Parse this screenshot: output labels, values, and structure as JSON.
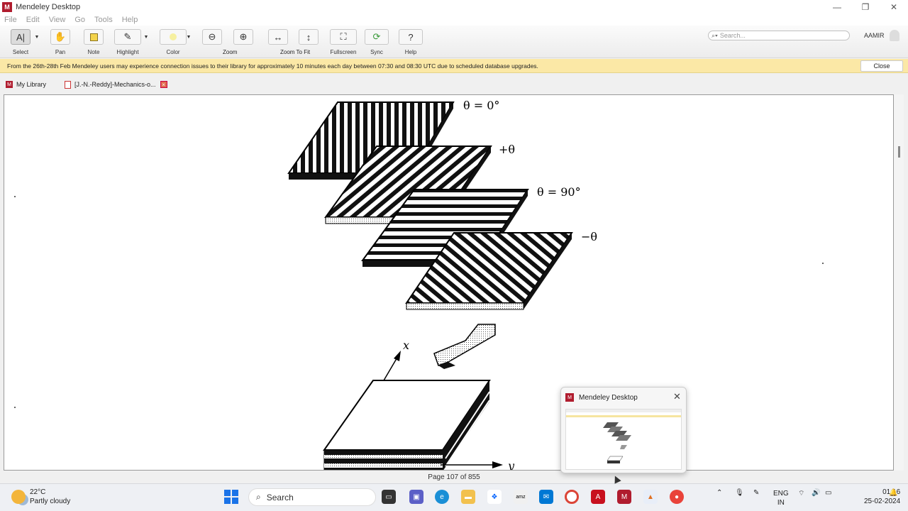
{
  "window": {
    "title": "Mendeley Desktop",
    "logo": "mendeley-logo"
  },
  "menu": [
    "File",
    "Edit",
    "View",
    "Go",
    "Tools",
    "Help"
  ],
  "toolbar": {
    "select": "Select",
    "pan": "Pan",
    "note": "Note",
    "highlight": "Highlight",
    "color": "Color",
    "zoom": "Zoom",
    "zoom_to_fit": "Zoom To Fit",
    "fullscreen": "Fullscreen",
    "sync": "Sync",
    "help": "Help"
  },
  "search": {
    "placeholder": "Search..."
  },
  "user": {
    "name": "AAMIR"
  },
  "banner": {
    "text": "From the 26th-28th Feb Mendeley users may experience connection issues to their library for approximately 10 minutes each day between 07:30 and 08:30 UTC due to scheduled database upgrades.",
    "close_label": "Close"
  },
  "tabs": [
    {
      "label": "My Library"
    },
    {
      "label": "[J.-N.-Reddy]-Mechanics-o..."
    }
  ],
  "figure": {
    "ply_labels": [
      "θ = 0°",
      "+θ",
      "θ = 90°",
      "−θ"
    ],
    "axis_x": "x",
    "axis_y": "y"
  },
  "status": {
    "page": "Page 107 of 855"
  },
  "preview": {
    "title": "Mendeley Desktop"
  },
  "taskbar": {
    "weather_temp": "22°C",
    "weather_desc": "Partly cloudy",
    "search_label": "Search",
    "lang_top": "ENG",
    "lang_bottom": "IN",
    "time": "01:16",
    "date": "25-02-2024"
  },
  "colors": {
    "brand": "#b01c2e",
    "banner": "#fbe8a6"
  }
}
